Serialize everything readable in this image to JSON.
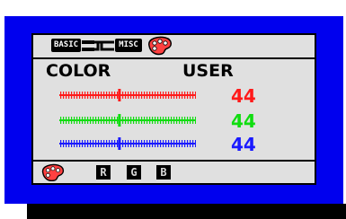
{
  "tabs": {
    "basic": "BASIC",
    "misc": "MISC"
  },
  "header": {
    "left": "COLOR",
    "right": "USER"
  },
  "rows": [
    {
      "channel": "red",
      "value": "44",
      "color": "#ff1a1a",
      "level": 0.44
    },
    {
      "channel": "green",
      "value": "44",
      "color": "#10dd10",
      "level": 0.44
    },
    {
      "channel": "blue",
      "value": "44",
      "color": "#1a1aff",
      "level": 0.44
    }
  ],
  "keys": [
    "R",
    "G",
    "B"
  ],
  "icons": [
    "palette-icon",
    "connector-icon"
  ]
}
